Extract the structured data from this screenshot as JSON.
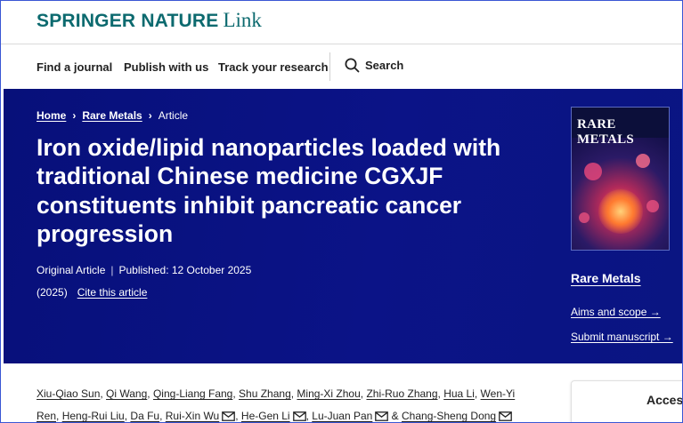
{
  "brand": {
    "main": "SPRINGER NATURE",
    "sub": "Link"
  },
  "nav": {
    "items": [
      "Find a journal",
      "Publish with us",
      "Track your research"
    ],
    "search_label": "Search"
  },
  "breadcrumb": {
    "home": "Home",
    "journal": "Rare Metals",
    "current": "Article",
    "separator": "›"
  },
  "article": {
    "title": "Iron oxide/lipid nanoparticles loaded with traditional Chinese medicine CGXJF constituents inhibit pancreatic cancer progression",
    "type": "Original Article",
    "published": "Published: 12 October 2025",
    "year": "(2025)",
    "cite": "Cite this article"
  },
  "journal": {
    "cover_title": "RARE METALS",
    "name": "Rare Metals",
    "aims": "Aims and scope →",
    "submit": "Submit manuscript →"
  },
  "authors": [
    {
      "name": "Xiu-Qiao Sun",
      "sep": ", ",
      "email": false
    },
    {
      "name": "Qi Wang",
      "sep": ", ",
      "email": false
    },
    {
      "name": "Qing-Liang Fang",
      "sep": ", ",
      "email": false
    },
    {
      "name": "Shu Zhang",
      "sep": ", ",
      "email": false
    },
    {
      "name": "Ming-Xi Zhou",
      "sep": ", ",
      "email": false
    },
    {
      "name": "Zhi-Ruo Zhang",
      "sep": ", ",
      "email": false
    },
    {
      "name": "Hua Li",
      "sep": ", ",
      "email": false
    },
    {
      "name": "Wen-Yi Ren",
      "sep": ", ",
      "email": false
    },
    {
      "name": "Heng-Rui Liu",
      "sep": ", ",
      "email": false
    },
    {
      "name": "Da Fu",
      "sep": ", ",
      "email": false
    },
    {
      "name": "Rui-Xin Wu",
      "sep": ", ",
      "email": true
    },
    {
      "name": "He-Gen Li",
      "sep": ", ",
      "email": true
    },
    {
      "name": "Lu-Juan Pan",
      "sep": " & ",
      "email": true
    },
    {
      "name": "Chang-Sheng Dong",
      "sep": "",
      "email": true
    }
  ],
  "access": {
    "label": "Access"
  },
  "colors": {
    "brand": "#0c6a6f",
    "hero_bg": "#0b1387",
    "frame": "#3a56d4"
  },
  "icons": {
    "search": "search-icon",
    "mail": "mail-icon",
    "arrow": "arrow-right-icon"
  }
}
